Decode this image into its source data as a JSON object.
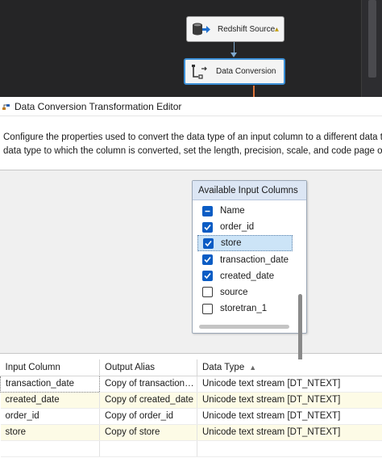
{
  "designer": {
    "source_task": {
      "label": "Redshift Source",
      "icon": "database-arrow-icon",
      "warning_icon": "warning-triangle-icon"
    },
    "conversion_task": {
      "label": "Data Conversion",
      "icon": "data-conversion-icon"
    }
  },
  "editor": {
    "title": "Data Conversion Transformation Editor",
    "description_line1": "Configure the properties used to convert the data type of an input column to a different data ty",
    "description_line2": "data type to which the column is converted, set the length, precision, scale, and code page of th"
  },
  "available_columns": {
    "title": "Available Input Columns",
    "items": [
      {
        "label": "Name",
        "state": "indeterminate"
      },
      {
        "label": "order_id",
        "state": "checked"
      },
      {
        "label": "store",
        "state": "checked",
        "selected": true
      },
      {
        "label": "transaction_date",
        "state": "checked"
      },
      {
        "label": "created_date",
        "state": "checked"
      },
      {
        "label": "source",
        "state": "unchecked"
      },
      {
        "label": "storetran_1",
        "state": "unchecked"
      }
    ]
  },
  "grid": {
    "headers": [
      "Input Column",
      "Output Alias",
      "Data Type"
    ],
    "sort_glyph": "▲",
    "rows": [
      [
        "transaction_date",
        "Copy of transaction_...",
        "Unicode text stream [DT_NTEXT]"
      ],
      [
        "created_date",
        "Copy of created_date",
        "Unicode text stream [DT_NTEXT]"
      ],
      [
        "order_id",
        "Copy of order_id",
        "Unicode text stream [DT_NTEXT]"
      ],
      [
        "store",
        "Copy of store",
        "Unicode text stream [DT_NTEXT]"
      ],
      [
        "",
        "",
        ""
      ]
    ]
  },
  "colors": {
    "canvas_bg": "#252526",
    "selected_task_border": "#3b8fd6",
    "checkbox_blue": "#0a5cc4",
    "selected_row": "#cce4f7",
    "alt_row": "#fdfbe6",
    "list_header": "#dce6f4"
  }
}
